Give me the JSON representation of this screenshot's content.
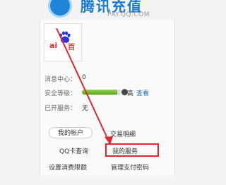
{
  "header": {
    "brand_title": "腾讯充值",
    "brand_url": "PAY.QQ.COM"
  },
  "avatar": {
    "logo_ai": "ai",
    "logo_du": "du",
    "logo_bai": "百"
  },
  "account_info": {
    "messages_label": "消息中心：",
    "messages_value": "0",
    "security_label": "安全等级：",
    "security_level": 0.9,
    "security_value": "高",
    "security_link": "查看",
    "services_label": "已开服务：",
    "services_value": "无"
  },
  "links": {
    "my_account": "我的帐户",
    "transaction_details": "交易明细",
    "qq_card_query": "QQ卡查询",
    "my_services": "我的服务",
    "set_spending_limit": "设置消费限额",
    "manage_pay_password": "管理支付密码"
  },
  "colors": {
    "highlight_red": "#e3262b",
    "security_green": "#6bbd2b",
    "brand_blue": "#1a7ad1"
  },
  "icons": {
    "brand_logo": "qq-recharge-logo",
    "avatar_logo": "baidu-paw-logo"
  }
}
